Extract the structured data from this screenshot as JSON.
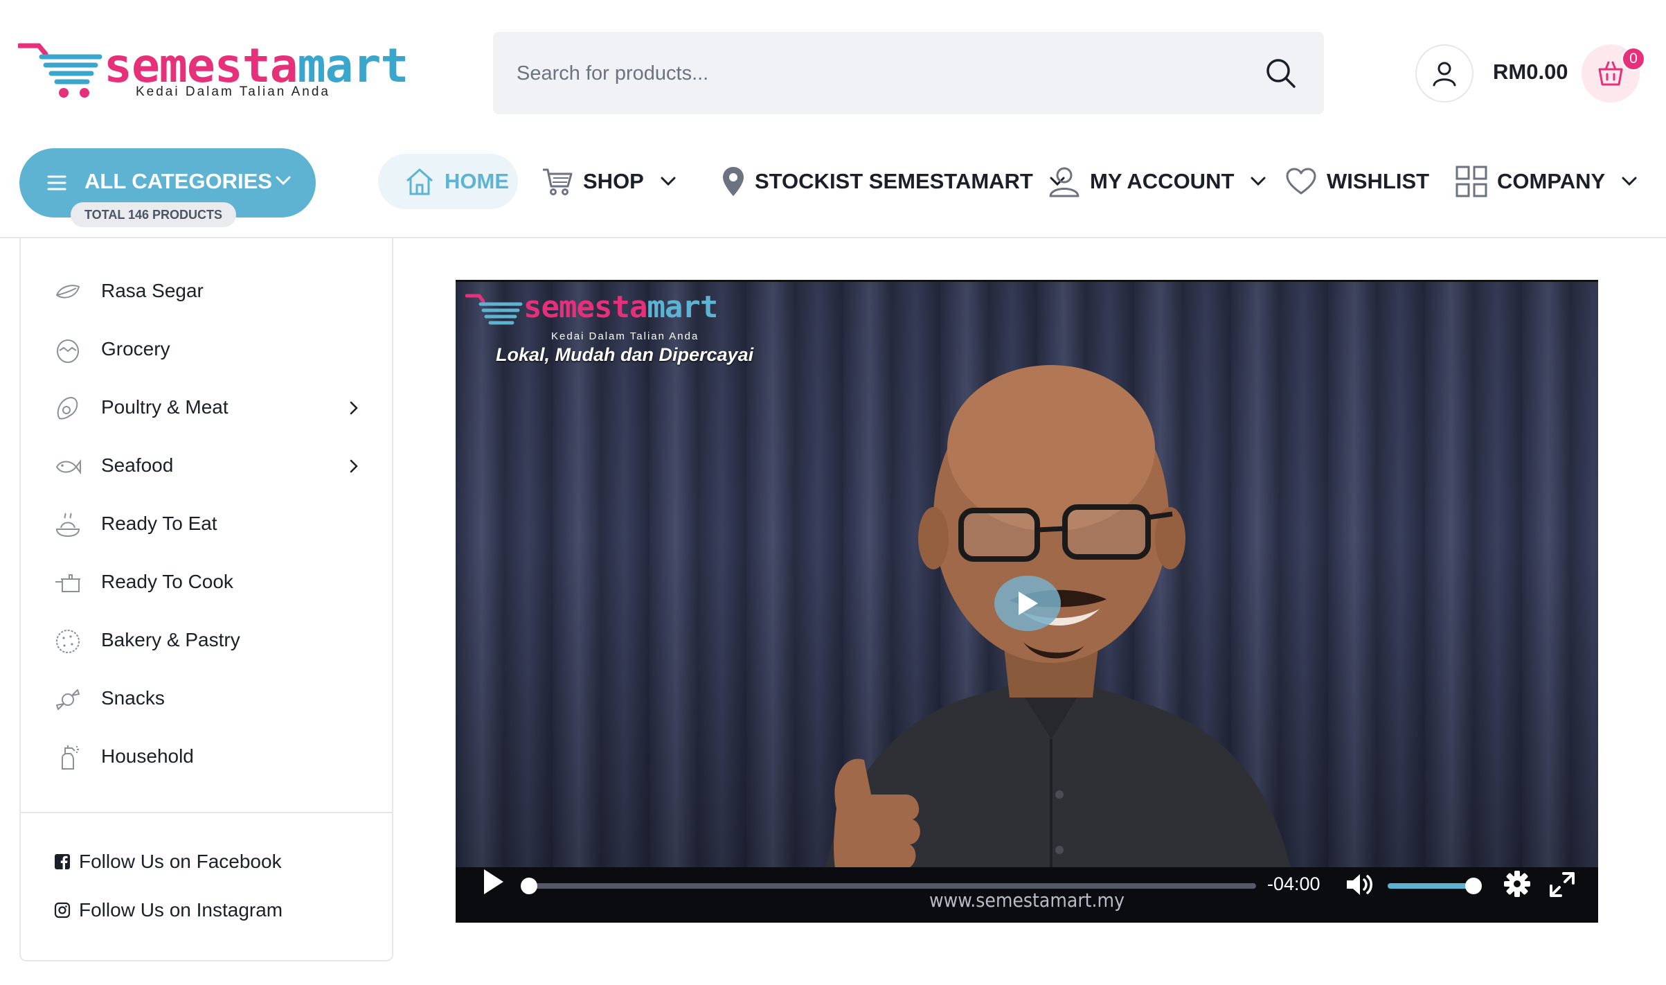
{
  "header": {
    "logo": {
      "part1": "semesta",
      "part2": "mart",
      "tagline": "Kedai Dalam Talian Anda"
    },
    "search": {
      "placeholder": "Search for products..."
    },
    "cart": {
      "total": "RM0.00",
      "count": "0"
    }
  },
  "nav": {
    "all_categories": {
      "label": "ALL CATEGORIES",
      "total_products": "TOTAL 146 PRODUCTS"
    },
    "items": [
      {
        "label": "HOME",
        "icon": "home-icon",
        "active": true
      },
      {
        "label": "SHOP",
        "icon": "cart-icon",
        "has_dropdown": true
      },
      {
        "label": "STOCKIST SEMESTAMART",
        "icon": "map-pin-icon",
        "has_dropdown": true
      },
      {
        "label": "MY ACCOUNT",
        "icon": "user-icon",
        "has_dropdown": true
      },
      {
        "label": "WISHLIST",
        "icon": "heart-icon"
      },
      {
        "label": "COMPANY",
        "icon": "grid-icon",
        "has_dropdown": true
      }
    ]
  },
  "sidebar": {
    "categories": [
      {
        "label": "Rasa Segar",
        "icon": "leaf-icon"
      },
      {
        "label": "Grocery",
        "icon": "egg-icon"
      },
      {
        "label": "Poultry & Meat",
        "icon": "meat-icon",
        "has_submenu": true
      },
      {
        "label": "Seafood",
        "icon": "fish-icon",
        "has_submenu": true
      },
      {
        "label": "Ready To Eat",
        "icon": "dish-icon"
      },
      {
        "label": "Ready To Cook",
        "icon": "pot-icon"
      },
      {
        "label": "Bakery & Pastry",
        "icon": "cookie-icon"
      },
      {
        "label": "Snacks",
        "icon": "candy-icon"
      },
      {
        "label": "Household",
        "icon": "spray-icon"
      }
    ],
    "social": [
      {
        "label": "Follow Us on Facebook",
        "icon": "facebook-icon"
      },
      {
        "label": "Follow Us on Instagram",
        "icon": "instagram-icon"
      }
    ]
  },
  "video": {
    "overlay_logo": {
      "part1": "semesta",
      "part2": "mart",
      "tagline": "Kedai Dalam Talian Anda"
    },
    "tagline": "Lokal, Mudah dan Dipercayai",
    "watermark": "www.semestamart.my",
    "time_remaining": "-04:00",
    "progress": 0,
    "volume": 1
  },
  "colors": {
    "brand_pink": "#e6307a",
    "brand_blue": "#5fb3d2",
    "text_dark": "#1b1f2a"
  }
}
